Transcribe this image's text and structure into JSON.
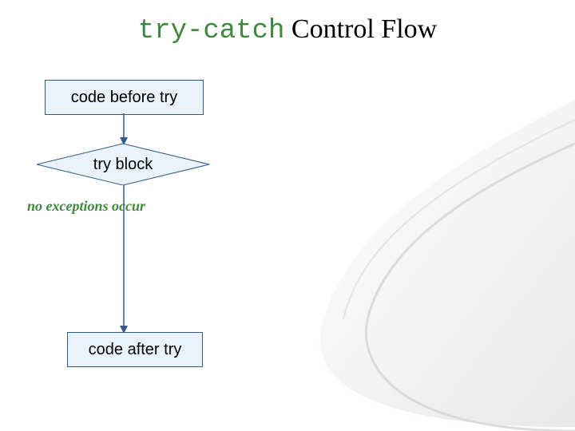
{
  "title": {
    "mono": "try-catch",
    "rest": " Control Flow"
  },
  "boxes": {
    "before": "code before try",
    "tryblock": "try block",
    "after": "code after try"
  },
  "condition": "no exceptions occur",
  "chart_data": {
    "type": "flowchart",
    "title": "try-catch Control Flow",
    "nodes": [
      {
        "id": "before",
        "type": "process",
        "label": "code before try"
      },
      {
        "id": "tryblock",
        "type": "decision",
        "label": "try block"
      },
      {
        "id": "after",
        "type": "process",
        "label": "code after try"
      }
    ],
    "edges": [
      {
        "from": "before",
        "to": "tryblock"
      },
      {
        "from": "tryblock",
        "to": "after",
        "label": "no exceptions occur"
      }
    ]
  }
}
